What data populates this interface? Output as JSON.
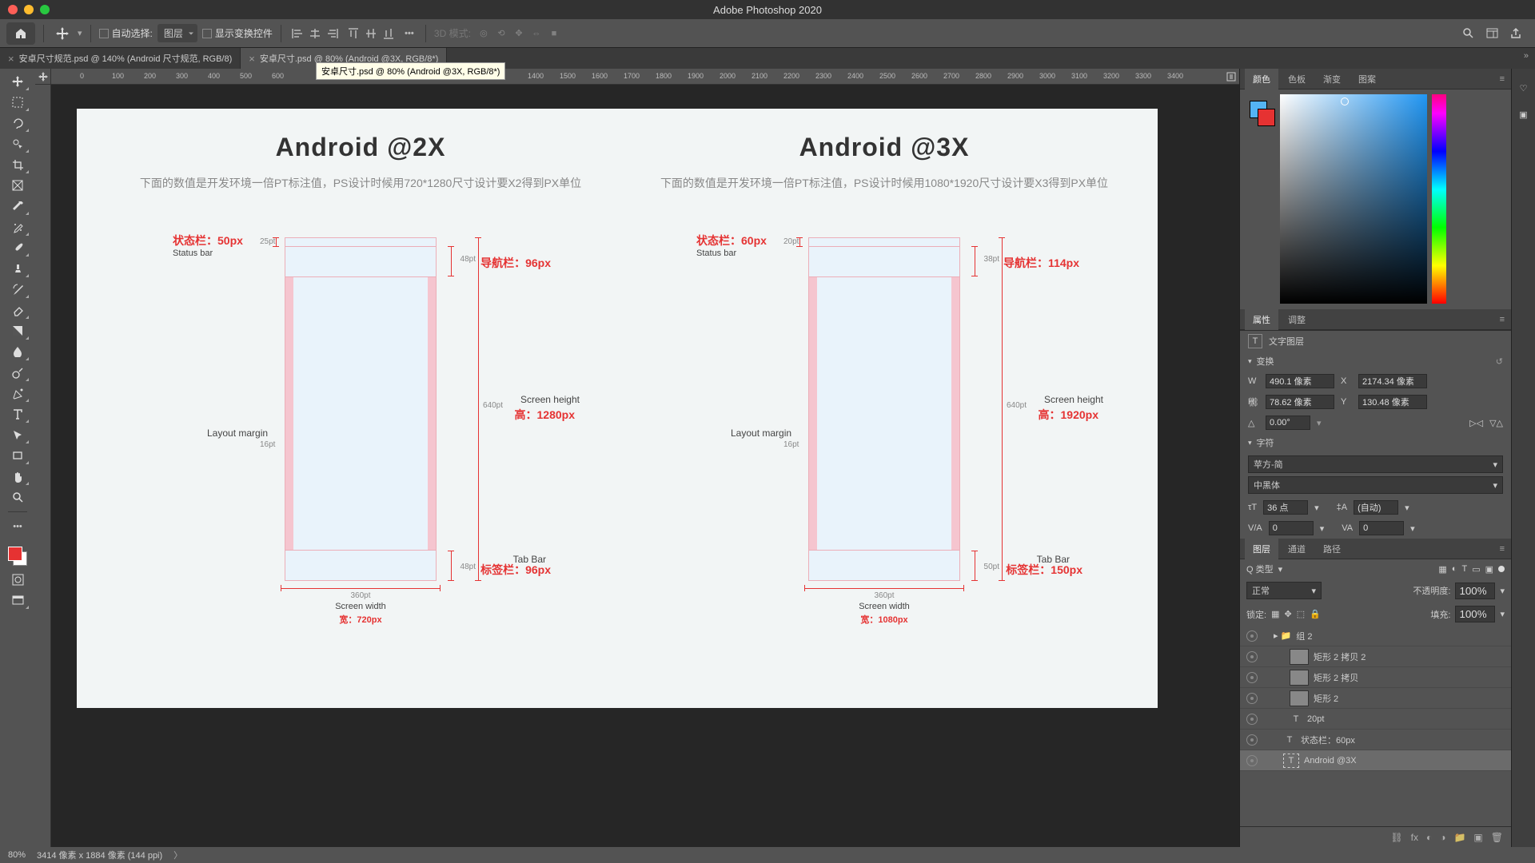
{
  "app_title": "Adobe Photoshop 2020",
  "options_bar": {
    "auto_select": "自动选择:",
    "layer_select": "图层",
    "show_transform": "显示变换控件",
    "mode_3d": "3D 模式:"
  },
  "tabs": [
    {
      "label": "安卓尺寸规范.psd @ 140% (Android 尺寸规范, RGB/8)",
      "active": false
    },
    {
      "label": "安卓尺寸.psd @ 80% (Android  @3X, RGB/8*)",
      "active": true
    }
  ],
  "tooltip": "安卓尺寸.psd @ 80% (Android  @3X, RGB/8*)",
  "ruler_marks": [
    "0",
    "100",
    "200",
    "300",
    "400",
    "500",
    "600",
    "",
    "",
    "",
    "",
    "",
    "",
    "1400",
    "1500",
    "1600",
    "1700",
    "1800",
    "1900",
    "2000",
    "2100",
    "2200",
    "2300",
    "2400",
    "2500",
    "2600",
    "2700",
    "2800",
    "2900",
    "3000",
    "3100",
    "3200",
    "3300",
    "3400"
  ],
  "canvas": {
    "left": {
      "title": "Android   @2X",
      "subtitle": "下面的数值是开发环境一倍PT标注值，PS设计时候用720*1280尺寸设计要X2得到PX单位",
      "status_label": "状态栏：50px",
      "status_en": "Status bar",
      "status_pt": "25pt",
      "nav_label": "导航栏：96px",
      "nav_pt": "48pt",
      "margin_label": "Layout margin",
      "margin_pt": "16pt",
      "height_en": "Screen height",
      "height_label": "高：1280px",
      "height_pt": "640pt",
      "tab_en": "Tab Bar",
      "tab_label": "标签栏：96px",
      "tab_pt": "48pt",
      "width_pt": "360pt",
      "width_en": "Screen width",
      "width_label": "宽：720px"
    },
    "right": {
      "title": "Android   @3X",
      "subtitle": "下面的数值是开发环境一倍PT标注值，PS设计时候用1080*1920尺寸设计要X3得到PX单位",
      "status_label": "状态栏：60px",
      "status_en": "Status bar",
      "status_pt": "20pt",
      "nav_label": "导航栏：114px",
      "nav_pt": "38pt",
      "margin_label": "Layout margin",
      "margin_pt": "16pt",
      "height_en": "Screen height",
      "height_label": "高：1920px",
      "height_pt": "640pt",
      "tab_en": "Tab Bar",
      "tab_label": "标签栏：150px",
      "tab_pt": "50pt",
      "width_pt": "360pt",
      "width_en": "Screen width",
      "width_label": "宽：1080px"
    }
  },
  "panels": {
    "color_tabs": [
      "颜色",
      "色板",
      "渐变",
      "图案"
    ],
    "props_tabs": [
      "属性",
      "调整"
    ],
    "props_type": "文字图层",
    "transform_hdr": "变换",
    "W": "490.1 像素",
    "X": "2174.34 像素",
    "H": "78.62 像素",
    "Y": "130.48 像素",
    "angle": "0.00°",
    "char_hdr": "字符",
    "font_family": "苹方-简",
    "font_weight": "中黑体",
    "font_size": "36 点",
    "leading": "(自动)",
    "va": "0",
    "tracking": "0",
    "layer_tabs": [
      "图层",
      "通道",
      "路径"
    ],
    "filter": "Q 类型",
    "blend": "正常",
    "opacity_lbl": "不透明度:",
    "opacity": "100%",
    "lock_lbl": "锁定:",
    "fill_lbl": "填充:",
    "fill": "100%",
    "layers": [
      {
        "name": "组 2",
        "type": "group"
      },
      {
        "name": "矩形 2 拷贝 2",
        "type": "shape"
      },
      {
        "name": "矩形 2 拷贝",
        "type": "shape"
      },
      {
        "name": "矩形 2",
        "type": "shape"
      },
      {
        "name": "20pt",
        "type": "text"
      },
      {
        "name": "状态栏：60px",
        "type": "text"
      },
      {
        "name": "Android  @3X",
        "type": "text",
        "selected": true
      }
    ]
  },
  "status_bar": {
    "zoom": "80%",
    "dims": "3414 像素 x 1884 像素 (144 ppi)"
  }
}
